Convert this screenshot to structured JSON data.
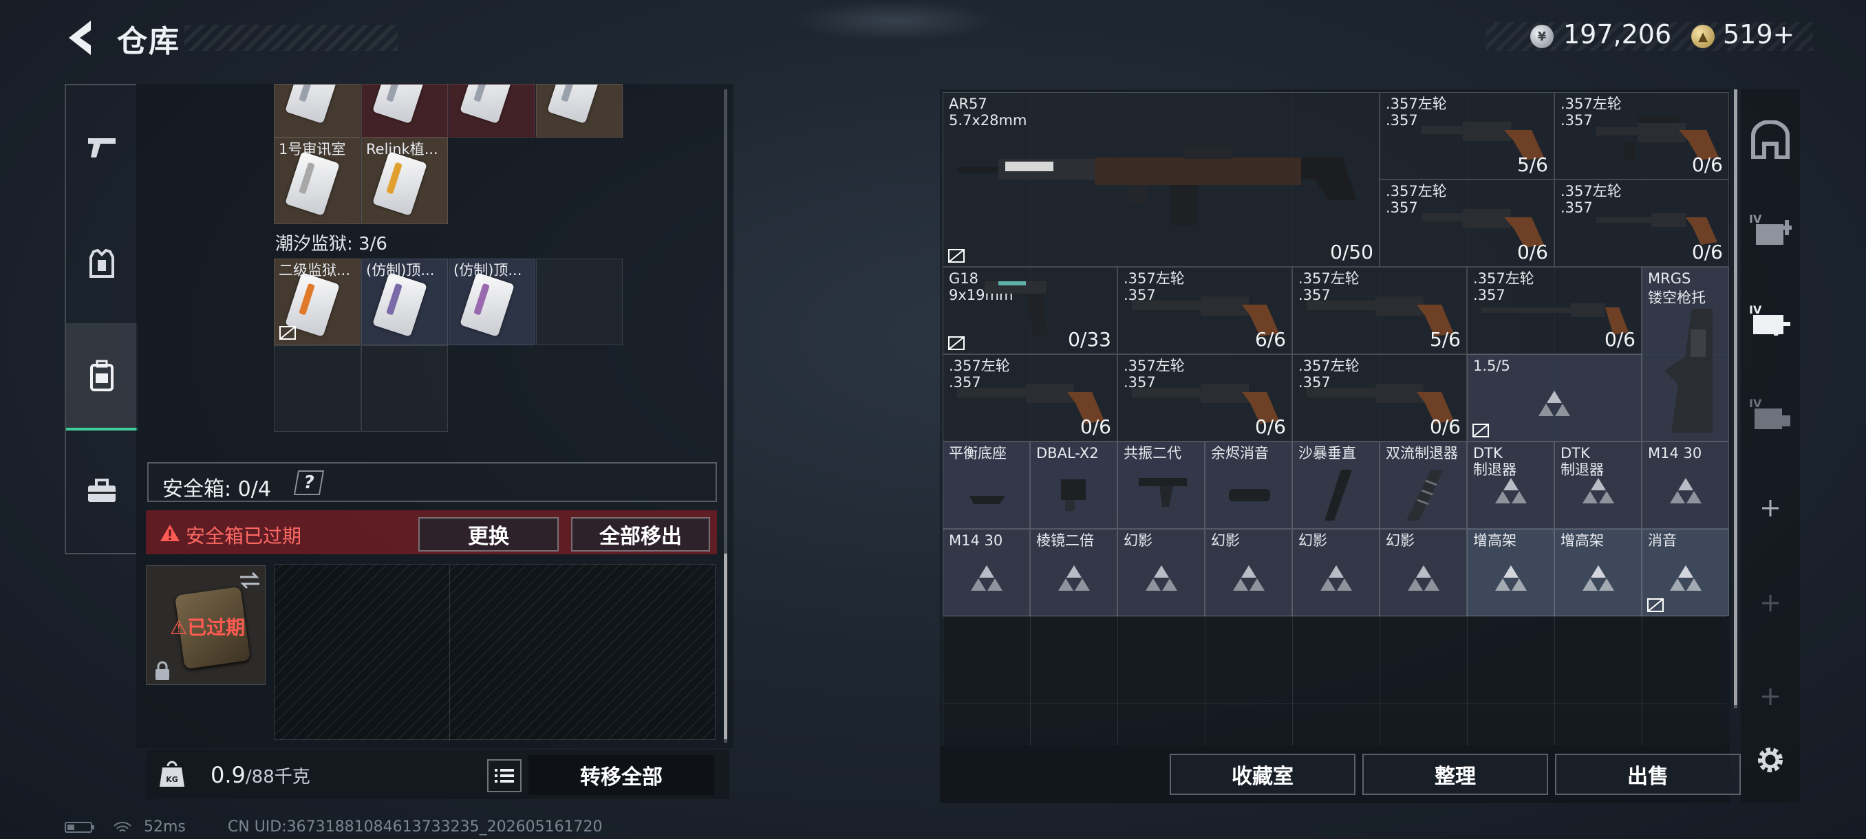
{
  "header": {
    "title": "仓库",
    "silver": "197,206",
    "gold": "519+"
  },
  "nav": [
    "weapons",
    "gear",
    "backpack",
    "toolbox"
  ],
  "left": {
    "keycards_top": [
      "",
      "",
      "",
      ""
    ],
    "keycards_mid": [
      "1号审讯室",
      "Relink植..."
    ],
    "section_label": "潮汐监狱: 3/6",
    "prison_cards": [
      "二级监狱...",
      "(仿制)顶...",
      "(仿制)顶..."
    ],
    "safebox_label": "安全箱: 0/4",
    "safebox_q": "?",
    "expired_text": "安全箱已过期",
    "replace_btn": "更换",
    "move_all_btn": "全部移出",
    "safe_slot_label": "已过期",
    "weight_value": "0.9",
    "weight_max": "/88千克",
    "kg_label": "KG",
    "transfer_all_btn": "转移全部"
  },
  "right": {
    "ar57": {
      "name": "AR57",
      "ammo": "5.7x28mm",
      "count": "0/50"
    },
    "revolvers": [
      {
        "name": ".357左轮",
        "ammo": ".357",
        "count": "5/6"
      },
      {
        "name": ".357左轮",
        "ammo": ".357",
        "count": "0/6"
      },
      {
        "name": ".357左轮",
        "ammo": ".357",
        "count": "0/6"
      },
      {
        "name": ".357左轮",
        "ammo": ".357",
        "count": "0/6"
      }
    ],
    "g18": {
      "name": "G18",
      "ammo": "9x19mm",
      "count": "0/33"
    },
    "row3_revolvers": [
      {
        "name": ".357左轮",
        "ammo": ".357",
        "count": "6/6"
      },
      {
        "name": ".357左轮",
        "ammo": ".357",
        "count": "5/6"
      },
      {
        "name": ".357左轮",
        "ammo": ".357",
        "count": "0/6"
      }
    ],
    "mrgs": {
      "name": "MRGS",
      "sub": "镂空枪托"
    },
    "row4_revolvers": [
      {
        "name": ".357左轮",
        "ammo": ".357",
        "count": "0/6"
      },
      {
        "name": ".357左轮",
        "ammo": ".357",
        "count": "0/6"
      },
      {
        "name": ".357左轮",
        "ammo": ".357",
        "count": "0/6"
      }
    ],
    "stack_item": {
      "name": "1.5/5"
    },
    "row5": [
      "平衡底座",
      "DBAL-X2",
      "共振二代",
      "余烬消音",
      "沙暴垂直",
      "双流制退器",
      "DTK\n制退器",
      "DTK\n制退器",
      "M14 30"
    ],
    "row6": [
      "M14 30",
      "棱镜二倍",
      "幻影",
      "幻影",
      "幻影",
      "幻影",
      "增高架",
      "增高架",
      "消音"
    ],
    "footer_buttons": [
      "收藏室",
      "整理",
      "出售"
    ]
  },
  "status": {
    "ping": "52ms",
    "uid": "CN UID:36731881084613733235_202605161720"
  },
  "colors": {
    "accent_green": "#3fcf9c",
    "expired_red": "#ff5b52"
  }
}
